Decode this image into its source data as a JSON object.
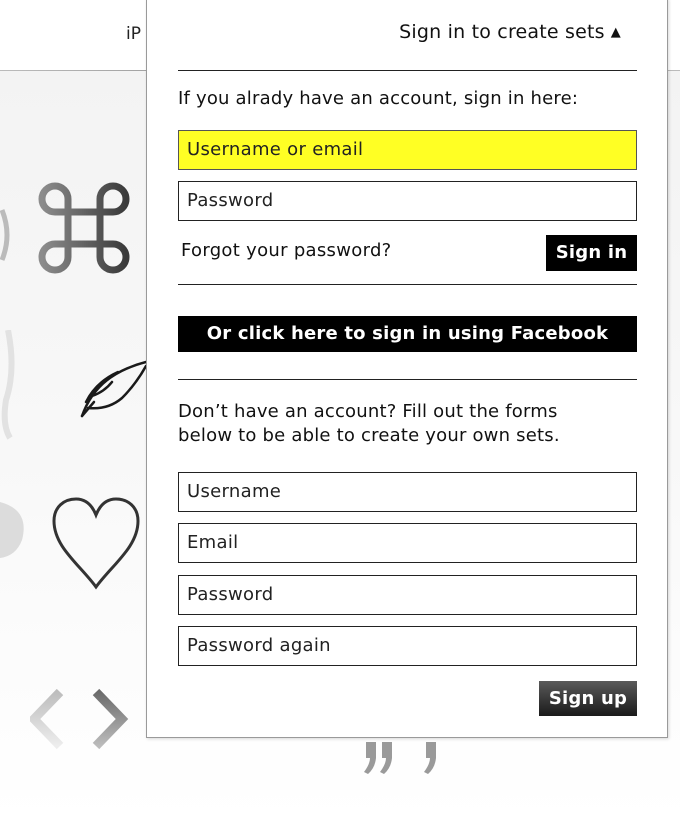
{
  "background": {
    "top_text": "iP",
    "gallery_icons": [
      "command-key-icon",
      "quill-pen-icon",
      "heart-outline-icon",
      "angle-brackets-icon",
      "closing-quote-icon"
    ]
  },
  "popup": {
    "header": "Sign in to create sets",
    "caret": "▲",
    "signin_intro": "If you alrady have an account, sign in here:",
    "username_placeholder": "Username or email",
    "password_placeholder": "Password",
    "forgot_label": "Forgot your password?",
    "signin_button": "Sign in",
    "facebook_button": "Or click here to sign in using Facebook",
    "signup_intro_line1": "Don’t have an account? Fill out the forms",
    "signup_intro_line2": "below to be able to create your own sets.",
    "signup_username_placeholder": "Username",
    "signup_email_placeholder": "Email",
    "signup_password_placeholder": "Password",
    "signup_password_again_placeholder": "Password again",
    "signup_button": "Sign up"
  },
  "colors": {
    "active_field_bg": "#ffff24",
    "button_bg": "#000000",
    "button_text": "#ffffff"
  }
}
